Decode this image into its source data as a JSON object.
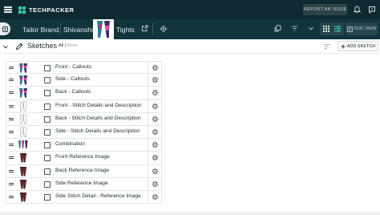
{
  "app": {
    "name": "TECHPACKER",
    "report_label": "REPORT AN ISSUE"
  },
  "breadcrumb": {
    "brand": "Tailor Brand",
    "collection": "Shivanshi",
    "product": "Tights"
  },
  "toolbar": {
    "doc_view_label": "DOC VIEW"
  },
  "sketches": {
    "title": "Sketches",
    "filter_all": "All",
    "filter_divider": "|",
    "filter_none": "None",
    "add_label": "ADD SKETCH",
    "items": [
      {
        "label": "Front - Callouts",
        "thumb": "tights-color"
      },
      {
        "label": "Side - Callouts",
        "thumb": "tights-color"
      },
      {
        "label": "Back - Callouts",
        "thumb": "tights-color"
      },
      {
        "label": "Front - Stitch Details and Description",
        "thumb": "tights-line"
      },
      {
        "label": "Back - Stitch Details and Description",
        "thumb": "tights-line"
      },
      {
        "label": "Side - Stitch Details and Description",
        "thumb": "tights-line"
      },
      {
        "label": "Combination",
        "thumb": "tights-combo"
      },
      {
        "label": "Front Reference Image",
        "thumb": "tights-photo"
      },
      {
        "label": "Back Reference Image",
        "thumb": "tights-photo"
      },
      {
        "label": "Side Reference Image",
        "thumb": "tights-photo"
      },
      {
        "label": "Side Stitch Detail - Reference Image",
        "thumb": "tights-photo"
      }
    ]
  },
  "colors": {
    "topbar": "#0e2a30",
    "subbar": "#12353c",
    "accent": "#3cc6b0",
    "tights_primary": "#2a7f8a",
    "tights_secondary": "#3b2a6a",
    "photo": "#5a2a2e"
  }
}
